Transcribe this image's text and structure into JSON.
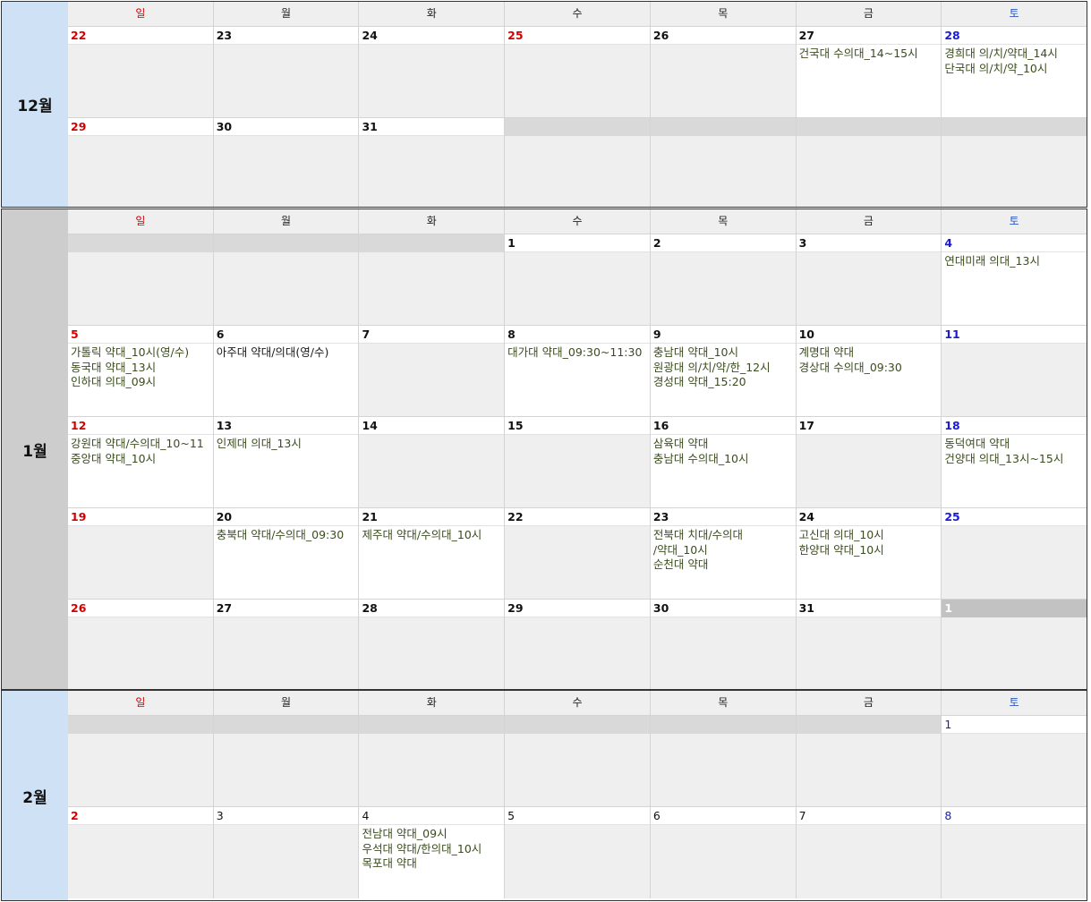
{
  "weekdays": [
    "일",
    "월",
    "화",
    "수",
    "목",
    "금",
    "토"
  ],
  "months": [
    {
      "label": "12월",
      "label_color": "blue",
      "weeks": [
        [
          {
            "d": "22",
            "c": "sun",
            "ev": []
          },
          {
            "d": "23",
            "ev": []
          },
          {
            "d": "24",
            "ev": []
          },
          {
            "d": "25",
            "c": "sun",
            "ev": []
          },
          {
            "d": "26",
            "ev": []
          },
          {
            "d": "27",
            "ev": [
              "건국대 수의대_14~15시"
            ]
          },
          {
            "d": "28",
            "c": "sat",
            "ev": [
              "경희대 의/치/약대_14시",
              "단국대 의/치/약_10시"
            ]
          }
        ],
        [
          {
            "d": "29",
            "c": "sun",
            "ev": []
          },
          {
            "d": "30",
            "ev": []
          },
          {
            "d": "31",
            "ev": []
          },
          {
            "empty": true
          },
          {
            "empty": true
          },
          {
            "empty": true
          },
          {
            "empty": true
          }
        ]
      ]
    },
    {
      "label": "1월",
      "label_color": "gray",
      "weeks": [
        [
          {
            "empty": true
          },
          {
            "empty": true
          },
          {
            "empty": true
          },
          {
            "d": "1",
            "ev": []
          },
          {
            "d": "2",
            "ev": []
          },
          {
            "d": "3",
            "ev": []
          },
          {
            "d": "4",
            "c": "sat",
            "ev": [
              "연대미래 의대_13시"
            ]
          }
        ],
        [
          {
            "d": "5",
            "c": "sun",
            "ev": [
              "가톨릭 약대_10시(영/수)",
              "동국대 약대_13시",
              "인하대 의대_09시"
            ]
          },
          {
            "d": "6",
            "ev": [
              "아주대 약대/의대(영/수)"
            ],
            "dark": true
          },
          {
            "d": "7",
            "ev": []
          },
          {
            "d": "8",
            "ev": [
              "대가대 약대_09:30~11:30"
            ]
          },
          {
            "d": "9",
            "ev": [
              "충남대 약대_10시",
              "원광대 의/치/약/한_12시",
              "경성대 약대_15:20"
            ]
          },
          {
            "d": "10",
            "ev": [
              "계명대 약대",
              "경상대 수의대_09:30"
            ]
          },
          {
            "d": "11",
            "c": "sat",
            "ev": []
          }
        ],
        [
          {
            "d": "12",
            "c": "sun",
            "ev": [
              "강원대 약대/수의대_10~11",
              "중앙대 약대_10시"
            ]
          },
          {
            "d": "13",
            "ev": [
              "인제대 의대_13시"
            ]
          },
          {
            "d": "14",
            "ev": []
          },
          {
            "d": "15",
            "ev": []
          },
          {
            "d": "16",
            "ev": [
              "삼육대 약대",
              "충남대 수의대_10시"
            ]
          },
          {
            "d": "17",
            "ev": []
          },
          {
            "d": "18",
            "c": "sat",
            "ev": [
              "동덕여대 약대",
              "건양대 의대_13시~15시"
            ]
          }
        ],
        [
          {
            "d": "19",
            "c": "sun",
            "ev": []
          },
          {
            "d": "20",
            "ev": [
              "충북대 약대/수의대_09:30"
            ]
          },
          {
            "d": "21",
            "ev": [
              "제주대 약대/수의대_10시"
            ]
          },
          {
            "d": "22",
            "ev": []
          },
          {
            "d": "23",
            "ev": [
              "전북대 치대/수의대",
              "/약대_10시",
              "순천대 약대"
            ]
          },
          {
            "d": "24",
            "ev": [
              "고신대 의대_10시",
              "한양대 약대_10시"
            ]
          },
          {
            "d": "25",
            "c": "sat",
            "ev": []
          }
        ],
        [
          {
            "d": "26",
            "c": "sun",
            "ev": []
          },
          {
            "d": "27",
            "ev": []
          },
          {
            "d": "28",
            "ev": []
          },
          {
            "d": "29",
            "ev": []
          },
          {
            "d": "30",
            "ev": []
          },
          {
            "d": "31",
            "ev": []
          },
          {
            "empty": true,
            "darker": true,
            "d": "1"
          }
        ]
      ]
    },
    {
      "label": "2월",
      "label_color": "blue",
      "weeks": [
        [
          {
            "empty": true
          },
          {
            "empty": true
          },
          {
            "empty": true
          },
          {
            "empty": true
          },
          {
            "empty": true
          },
          {
            "empty": true
          },
          {
            "d": "1",
            "c": "sat",
            "thin": true,
            "ev": []
          }
        ],
        [
          {
            "d": "2",
            "c": "sun",
            "ev": []
          },
          {
            "d": "3",
            "thin": true,
            "ev": []
          },
          {
            "d": "4",
            "thin": true,
            "ev": [
              "전남대 약대_09시",
              "우석대 약대/한의대_10시",
              "목포대 약대"
            ]
          },
          {
            "d": "5",
            "thin": true,
            "ev": []
          },
          {
            "d": "6",
            "thin": true,
            "ev": []
          },
          {
            "d": "7",
            "thin": true,
            "ev": []
          },
          {
            "d": "8",
            "c": "sat",
            "thin": true,
            "ev": []
          }
        ]
      ]
    }
  ]
}
